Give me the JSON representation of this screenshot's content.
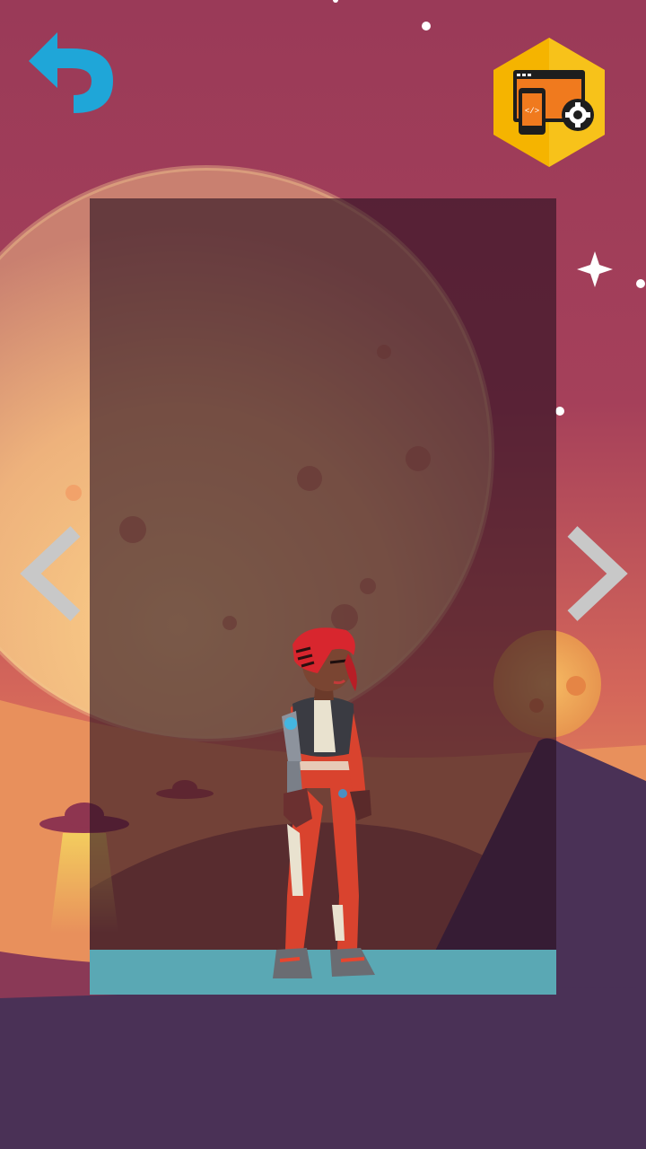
{
  "screen": {
    "name": "character-select",
    "colors": {
      "sky_top": "#9A3A58",
      "sky_mid": "#C8565A",
      "sky_low": "#E08A5A",
      "ground": "#4A3156",
      "panel_overlay": "#2A1020",
      "floor_strip": "#5AA8B4",
      "planet": "#E8B27A",
      "arrow": "#C8C8C8",
      "back_icon": "#1FA6D8",
      "settings_hex": "#F5B400"
    }
  },
  "back_button": {
    "icon": "undo-arrow-icon"
  },
  "settings_button": {
    "icon": "device-settings-icon"
  },
  "nav": {
    "prev_icon": "chevron-left-icon",
    "next_icon": "chevron-right-icon"
  },
  "character": {
    "description_icon": "astronaut-character",
    "hair_color": "#D8262E",
    "suit_color": "#D9432E"
  }
}
